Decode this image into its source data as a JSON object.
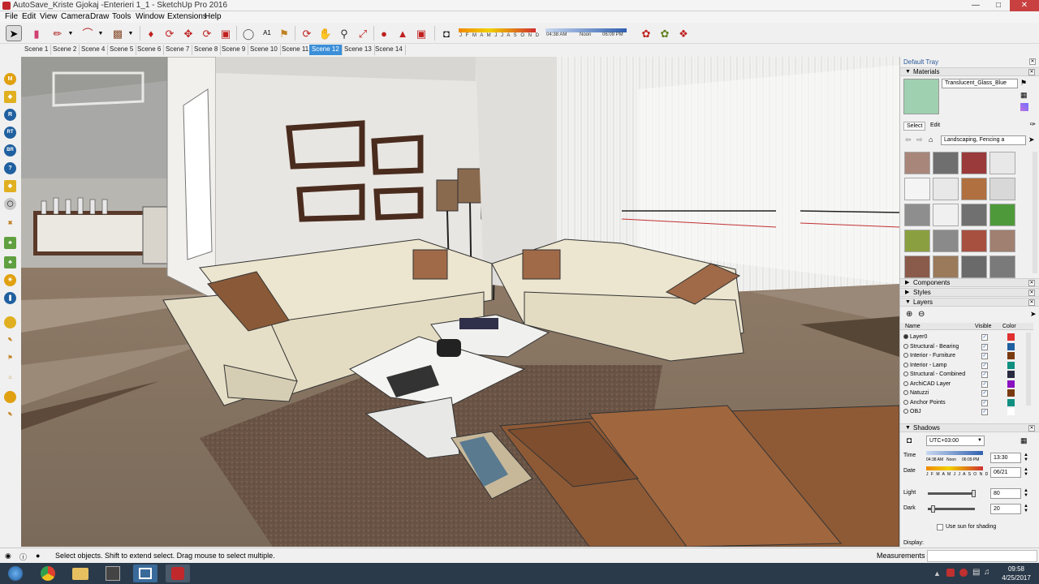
{
  "window": {
    "title": "AutoSave_Kriste Gjokaj -Enterieri 1_1 - SketchUp Pro 2016"
  },
  "menu": [
    "File",
    "Edit",
    "View",
    "Camera",
    "Draw",
    "Tools",
    "Window",
    "Extensions",
    "Help"
  ],
  "toolbar": {
    "months": "J F M A M J J A S O N D",
    "time_start": "04:38 AM",
    "time_noon": "Noon",
    "time_end": "06:09 PM",
    "tools": [
      "select-tool",
      "eraser-tool",
      "line-tool",
      "arc-tool",
      "rectangle-tool",
      "push-pull-tool",
      "follow-me-tool",
      "move-tool",
      "rotate-tool",
      "scale-tool",
      "tape-measure-tool",
      "text-tool",
      "paint-bucket-tool",
      "orbit-tool",
      "pan-tool",
      "zoom-tool",
      "zoom-extents-tool",
      "add-location-tool",
      "terrain-tool",
      "photo-texture-tool",
      "shadows-tool",
      "extension-tool-1",
      "extension-tool-2",
      "extension-tool-3"
    ]
  },
  "scenes": [
    "Scene 1",
    "Scene 2",
    "Scene 4",
    "Scene 5",
    "Scene 6",
    "Scene 7",
    "Scene 8",
    "Scene 9",
    "Scene 10",
    "Scene 11",
    "Scene 12",
    "Scene 13",
    "Scene 14"
  ],
  "active_scene": "Scene 12",
  "left_tools": [
    "M",
    "",
    "R",
    "RT",
    "BR",
    "?",
    "",
    "",
    "",
    "",
    "",
    "",
    "",
    "",
    "",
    "",
    "",
    "",
    "",
    ""
  ],
  "tray": {
    "title": "Default Tray",
    "materials": {
      "header": "Materials",
      "current_material": "Translucent_Glass_Blue",
      "current_color": "#9fd0b0",
      "tab_select": "Select",
      "tab_edit": "Edit",
      "collection": "Landscaping, Fencing a",
      "swatches": [
        "#a8867a",
        "#6f6f6f",
        "#9a3a3a",
        "#e8e8e8",
        "#f4f4f4",
        "#e8e8e8",
        "#b07040",
        "#d8d8d8",
        "#8e8e8e",
        "#f0f0f0",
        "#707070",
        "#4e9a3a",
        "#8aa040",
        "#8a8a8a",
        "#a85040",
        "#a08070",
        "#8a5a4a",
        "#9a7a5a",
        "#6a6a6a",
        "#7a7a7a"
      ]
    },
    "components": {
      "header": "Components"
    },
    "styles": {
      "header": "Styles"
    },
    "layers": {
      "header": "Layers",
      "col_name": "Name",
      "col_visible": "Visible",
      "col_color": "Color",
      "rows": [
        {
          "name": "Layer0",
          "color": "#e03030"
        },
        {
          "name": "Structural - Bearing",
          "color": "#2060a0"
        },
        {
          "name": "Interior - Furniture",
          "color": "#7a3a10"
        },
        {
          "name": "Interior - Lamp",
          "color": "#109080"
        },
        {
          "name": "Structural - Combined",
          "color": "#2a2a40"
        },
        {
          "name": "ArchiCAD Layer",
          "color": "#8a10c0"
        },
        {
          "name": "Natuzzi",
          "color": "#7a3a10"
        },
        {
          "name": "Anchor Points",
          "color": "#109080"
        },
        {
          "name": "OBJ",
          "color": "#ffffff"
        }
      ]
    },
    "shadows": {
      "header": "Shadows",
      "utc": "UTC+03:00",
      "time_label": "Time",
      "time_start": "04:38 AM",
      "time_noon": "Noon",
      "time_end": "06:09 PM",
      "time_value": "13:30",
      "date_label": "Date",
      "months": "J F M A M J J A S O N D",
      "date_value": "06/21",
      "light_label": "Light",
      "light_value": "80",
      "dark_label": "Dark",
      "dark_value": "20",
      "use_sun": "Use sun for shading",
      "display_label": "Display:"
    }
  },
  "status": {
    "hint": "Select objects. Shift to extend select. Drag mouse to select multiple.",
    "measurements": "Measurements"
  },
  "taskbar": {
    "time": "09:58",
    "date": "4/25/2017"
  }
}
